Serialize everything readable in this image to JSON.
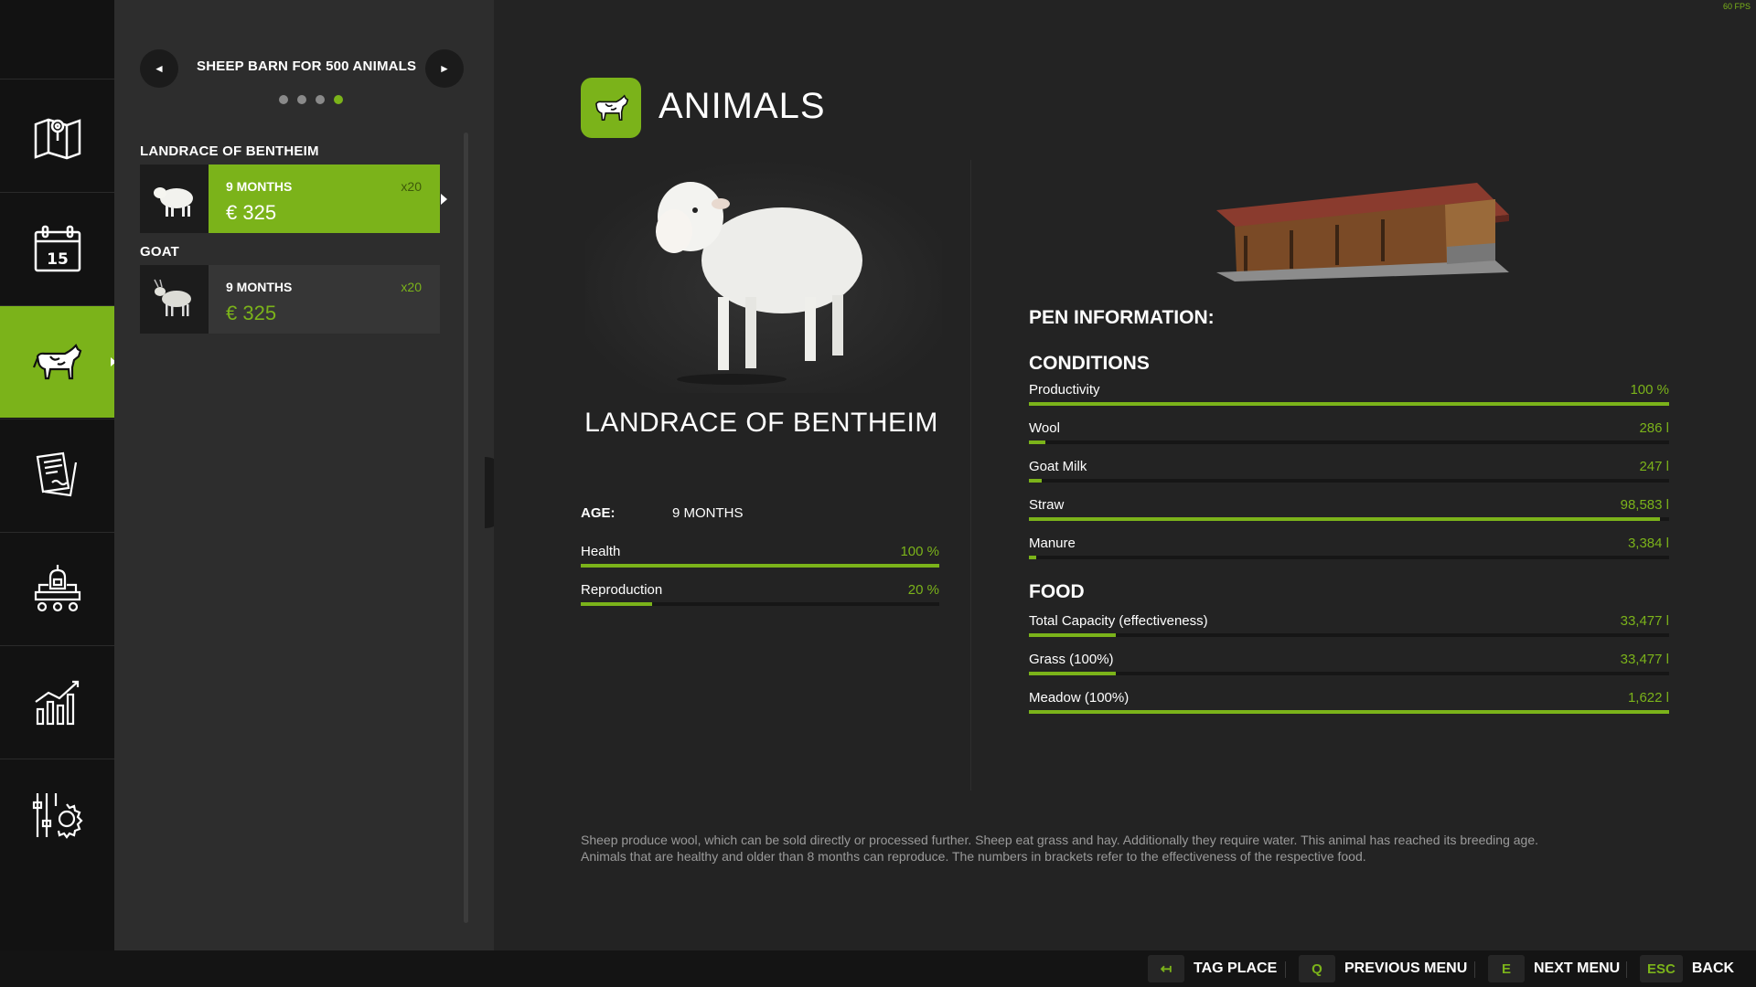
{
  "fps": "60 FPS",
  "side": {
    "title": "SHEEP BARN FOR 500 ANIMALS",
    "page_count": 4,
    "active_page": 4,
    "groups": [
      {
        "label": "LANDRACE OF BENTHEIM",
        "age": "9 MONTHS",
        "qty": "x20",
        "price": "€ 325",
        "selected": true
      },
      {
        "label": "GOAT",
        "age": "9 MONTHS",
        "qty": "x20",
        "price": "€ 325",
        "selected": false
      }
    ]
  },
  "rail": {
    "items": [
      {
        "icon": "map-icon"
      },
      {
        "icon": "calendar-icon",
        "badge": "15"
      },
      {
        "icon": "cow-icon",
        "active": true
      },
      {
        "icon": "contracts-icon"
      },
      {
        "icon": "production-icon"
      },
      {
        "icon": "statistics-icon"
      },
      {
        "icon": "settings-icon"
      }
    ]
  },
  "main": {
    "title": "ANIMALS",
    "animal_name": "LANDRACE OF BENTHEIM",
    "age_label": "AGE:",
    "age_value": "9 MONTHS",
    "stats": [
      {
        "name": "Health",
        "value": "100 %",
        "level": 1.0
      },
      {
        "name": "Reproduction",
        "value": "20 %",
        "level": 0.2
      }
    ],
    "pen_heading": "PEN INFORMATION:",
    "conditions_heading": "CONDITIONS",
    "conditions": [
      {
        "name": "Productivity",
        "value": "100 %",
        "level": 1.0
      },
      {
        "name": "Wool",
        "value": "286 l",
        "level": 0.025
      },
      {
        "name": "Goat Milk",
        "value": "247 l",
        "level": 0.02
      },
      {
        "name": "Straw",
        "value": "98,583 l",
        "level": 0.985
      },
      {
        "name": "Manure",
        "value": "3,384 l",
        "level": 0.012
      }
    ],
    "food_heading": "FOOD",
    "food": [
      {
        "name": "Total Capacity (effectiveness)",
        "value": "33,477 l",
        "level": 0.135
      },
      {
        "name": "Grass (100%)",
        "value": "33,477 l",
        "level": 0.135
      },
      {
        "name": "Meadow (100%)",
        "value": "1,622 l",
        "level": 1.0
      }
    ],
    "description_line1": "Sheep produce wool, which can be sold directly or processed further. Sheep eat grass and hay. Additionally they require water. This animal has reached its breeding age.",
    "description_line2": "Animals that are healthy and older than 8 months can reproduce. The numbers in brackets refer to the effectiveness of the respective food."
  },
  "bottom": {
    "hints": [
      {
        "key": "↤",
        "label": "TAG PLACE"
      },
      {
        "key": "Q",
        "label": "PREVIOUS MENU"
      },
      {
        "key": "E",
        "label": "NEXT MENU"
      },
      {
        "key": "ESC",
        "label": "BACK"
      }
    ]
  },
  "colors": {
    "accent": "#7bb31a",
    "background": "#232323",
    "panel": "#2d2d2d",
    "rail": "#121212"
  }
}
